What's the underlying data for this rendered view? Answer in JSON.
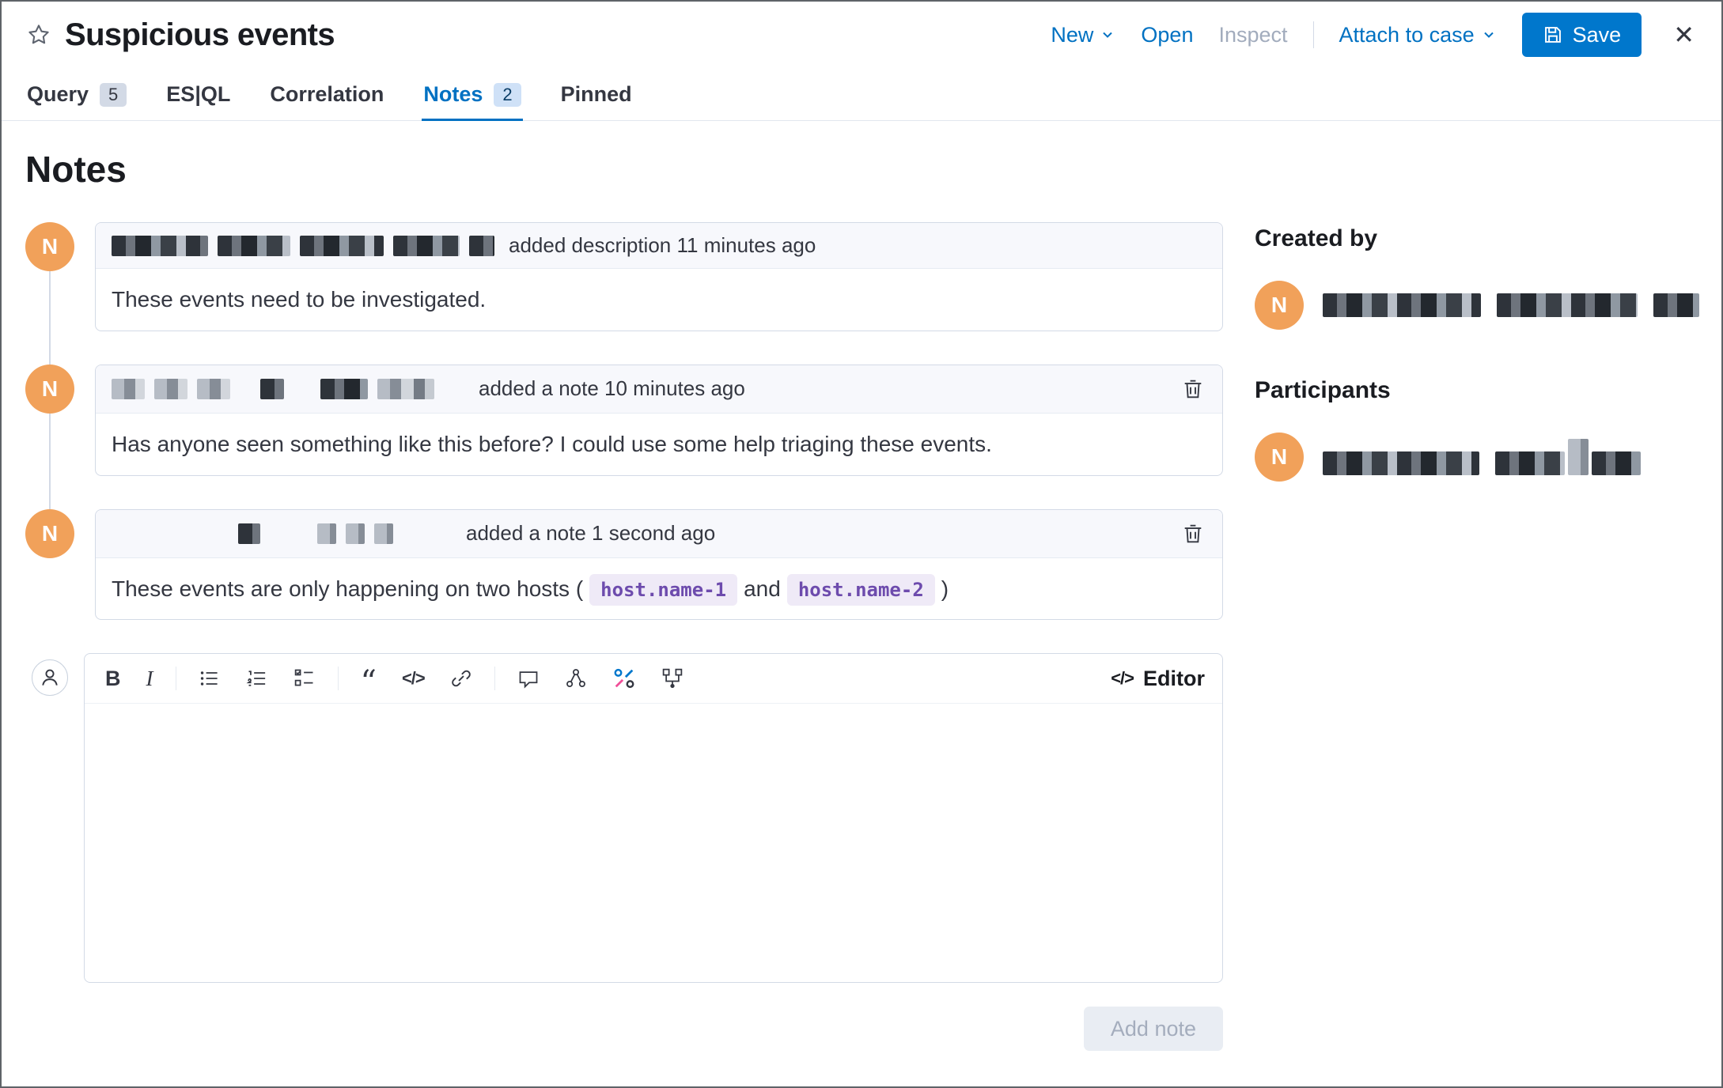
{
  "header": {
    "title": "Suspicious events",
    "actions": {
      "new": "New",
      "open": "Open",
      "inspect": "Inspect",
      "attach": "Attach to case",
      "save": "Save"
    }
  },
  "tabs": [
    {
      "label": "Query",
      "badge": "5"
    },
    {
      "label": "ES|QL",
      "badge": ""
    },
    {
      "label": "Correlation",
      "badge": ""
    },
    {
      "label": "Notes",
      "badge": "2"
    },
    {
      "label": "Pinned",
      "badge": ""
    }
  ],
  "notes_page": {
    "heading": "Notes",
    "notes": [
      {
        "avatar": "N",
        "event": "added description 11 minutes ago",
        "body": "These events need to be investigated."
      },
      {
        "avatar": "N",
        "event": "added a note 10 minutes ago",
        "body": "Has anyone seen something like this before? I could use some help triaging these events."
      },
      {
        "avatar": "N",
        "event": "added a note 1 second ago",
        "body_prefix": "These events are only happening on two hosts (",
        "host1": "host.name-1",
        "conjunction": "and",
        "host2": "host.name-2",
        "body_suffix": ")"
      }
    ],
    "editor": {
      "label": "Editor",
      "add_note_label": "Add note"
    },
    "sidebar": {
      "created_by_heading": "Created by",
      "participants_heading": "Participants",
      "avatar": "N"
    }
  },
  "icons": {
    "bold": "B",
    "italic": "I",
    "quote": "“",
    "code": "</>",
    "editor_toggle": "</>",
    "close": "✕"
  },
  "colors": {
    "primary_link": "#0071c2",
    "save_button": "#0077cc",
    "avatar_orange": "#f1a15a",
    "inline_code": "#6d4bad",
    "active_tab": "#0071c2"
  }
}
